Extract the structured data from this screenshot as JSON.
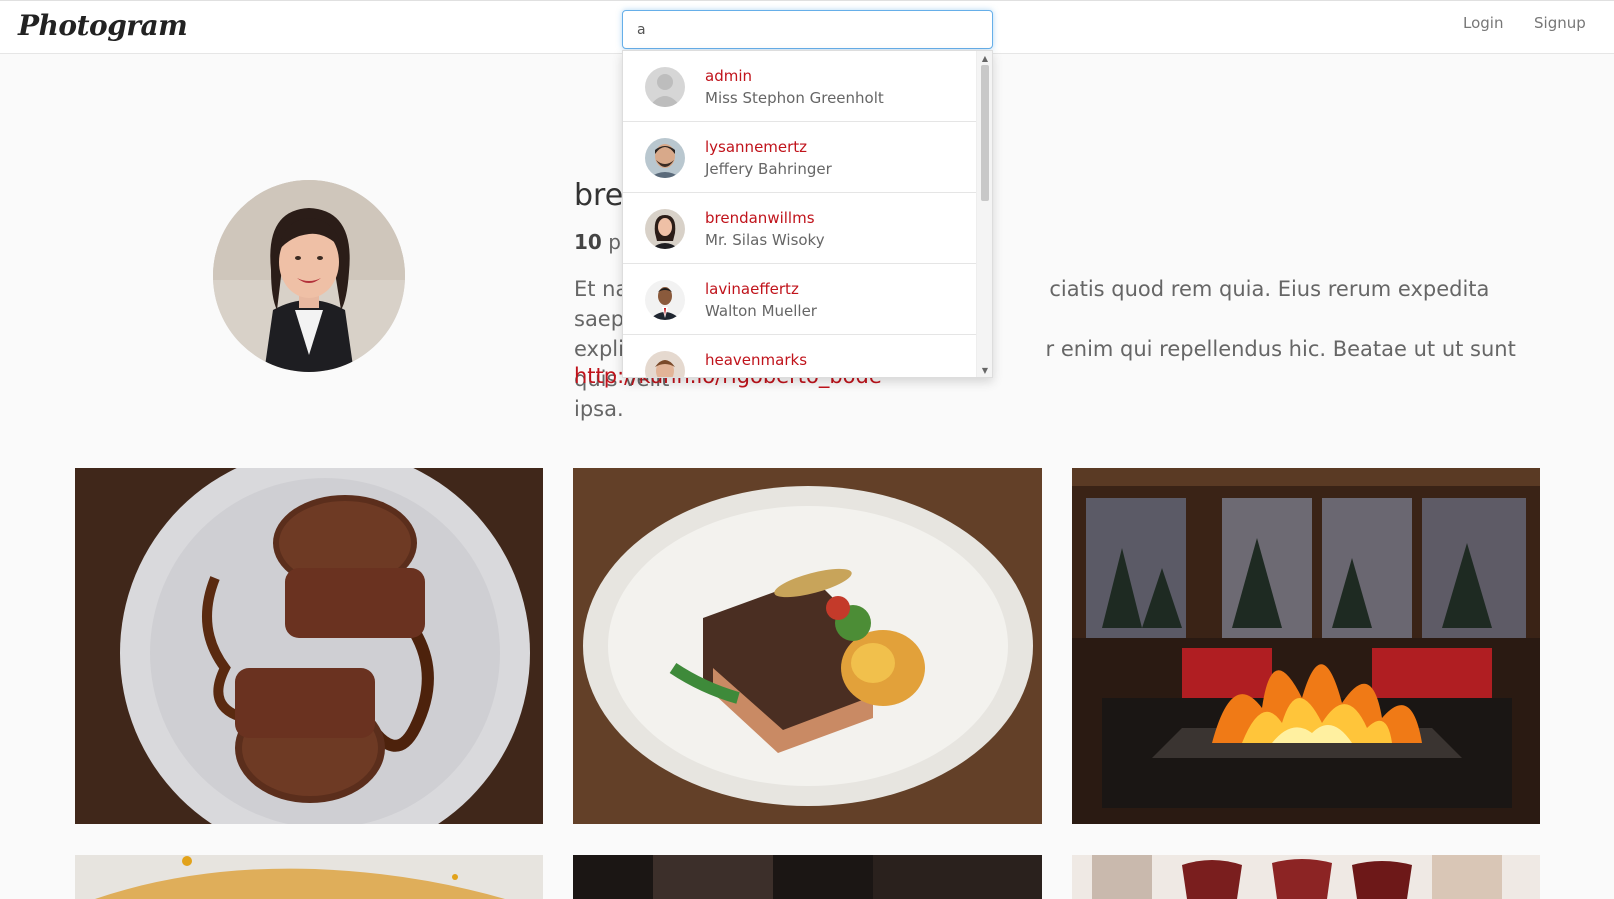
{
  "navbar": {
    "brand": "Photogram",
    "search_value": "a",
    "login": "Login",
    "signup": "Signup"
  },
  "profile": {
    "name_visible": "bre",
    "posts_count": "10",
    "posts_label_visible": "po",
    "bio_line1_left": "Et na",
    "bio_line1_right": "ciatis quod rem quia. Eius rerum expedita saepe",
    "bio_line2_left": "explic",
    "bio_line2_right": "r enim qui repellendus hic. Beatae ut ut sunt quis velit",
    "bio_line3": "ipsa.",
    "url": "http://kuhn.io/rigoberto_bode"
  },
  "search_results": [
    {
      "username": "admin",
      "full_name": "Miss Stephon Greenholt",
      "avatar": "default-avatar-icon"
    },
    {
      "username": "lysannemertz",
      "full_name": "Jeffery Bahringer",
      "avatar": "man-beard-photo"
    },
    {
      "username": "brendanwillms",
      "full_name": "Mr. Silas Wisoky",
      "avatar": "woman-photo"
    },
    {
      "username": "lavinaeffertz",
      "full_name": "Walton Mueller",
      "avatar": "man-suit-photo"
    },
    {
      "username": "heavenmarks",
      "full_name": "",
      "avatar": "man-photo"
    }
  ],
  "colors": {
    "accent": "#c0131b",
    "focus": "#66afe9"
  }
}
